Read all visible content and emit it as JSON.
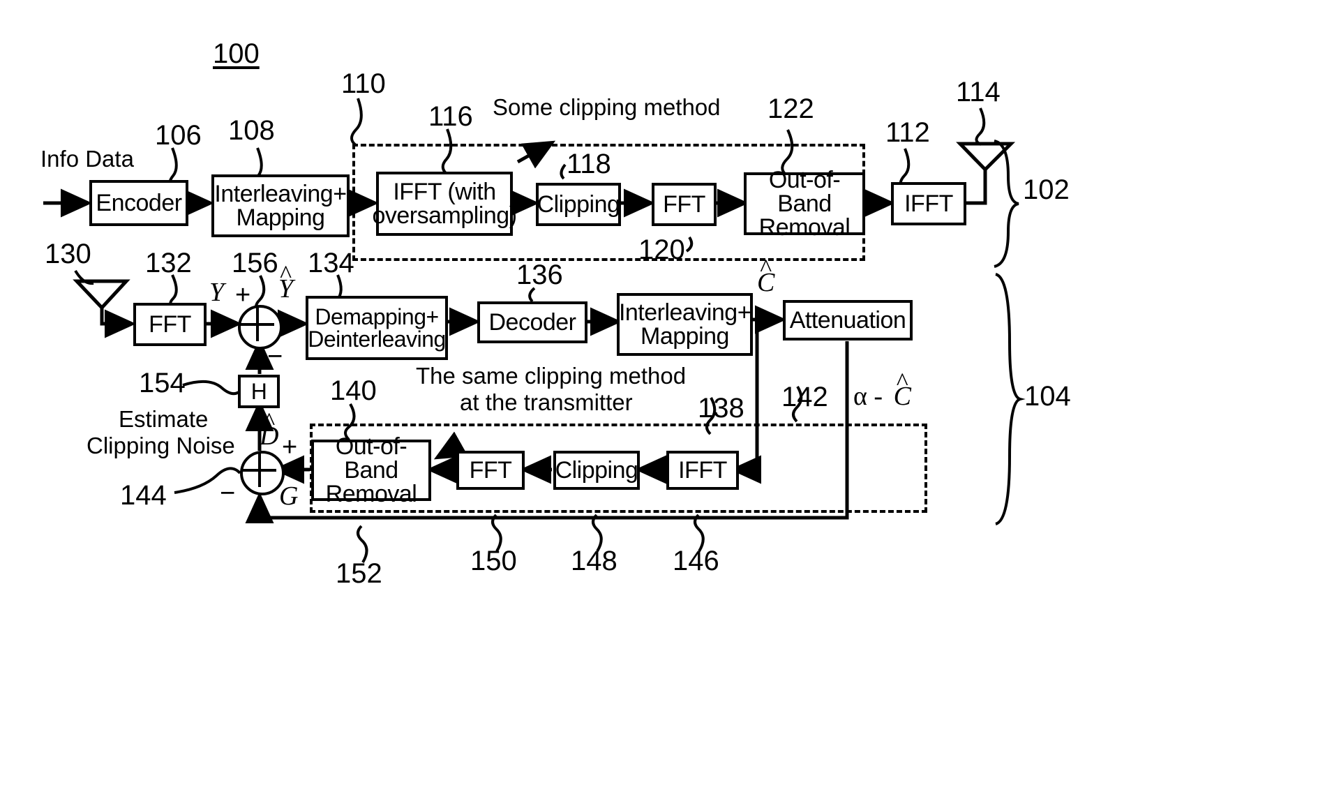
{
  "figure": {
    "number": "100",
    "title_note_transmitter": "Some clipping method",
    "title_note_receiver_line1": "The same clipping method",
    "title_note_receiver_line2": "at the transmitter",
    "estimate_label_line1": "Estimate",
    "estimate_label_line2": "Clipping Noise",
    "input_label": "Info Data"
  },
  "transmitter": {
    "ref": "102",
    "blocks": [
      {
        "ref": "106",
        "label": "Encoder"
      },
      {
        "ref": "108",
        "label_line1": "Interleaving+",
        "label_line2": "Mapping"
      },
      {
        "ref": "116",
        "label_line1": "IFFT (with",
        "label_line2": "oversampling)"
      },
      {
        "ref": "118",
        "label": "Clipping"
      },
      {
        "ref": "120",
        "label": "FFT"
      },
      {
        "ref": "122",
        "label_line1": "Out-of-Band",
        "label_line2": "Removal"
      },
      {
        "ref": "112",
        "label": "IFFT"
      }
    ],
    "clipping_group_ref": "110",
    "antenna_ref": "114"
  },
  "receiver": {
    "ref": "104",
    "antenna_ref": "130",
    "blocks": [
      {
        "ref": "132",
        "label": "FFT"
      },
      {
        "ref": "134",
        "label_line1": "Demapping+",
        "label_line2": "Deinterleaving"
      },
      {
        "ref": "136",
        "label": "Decoder"
      },
      {
        "ref": "138",
        "label_line1": "Interleaving+",
        "label_line2": "Mapping"
      },
      {
        "ref": "142",
        "label": "Attenuation"
      },
      {
        "ref": "146",
        "label": "IFFT"
      },
      {
        "ref": "148",
        "label": "Clipping"
      },
      {
        "ref": "150",
        "label": "FFT"
      },
      {
        "ref": "152",
        "label_line1": "Out-of-Band",
        "label_line2": "Removal"
      },
      {
        "ref": "154",
        "label": "H"
      }
    ],
    "clipping_group_ref": "140",
    "summing_node_top_ref": "156",
    "summing_node_bottom_ref": "144"
  },
  "signals": {
    "Y": "Y",
    "Y_hat_base": "Y",
    "C_hat_base": "C",
    "D_hat_base": "D",
    "G": "G",
    "hat": "^",
    "alpha_minus_Chat_prefix": "α -",
    "alpha_minus_Chat_base": "C",
    "plus": "+",
    "minus": "−"
  },
  "colors": {
    "ink": "#000000",
    "paper": "#ffffff"
  }
}
